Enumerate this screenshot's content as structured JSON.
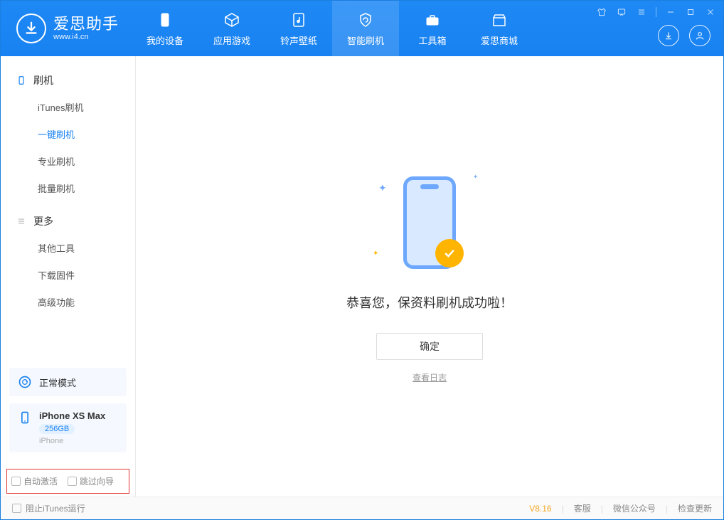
{
  "app": {
    "title": "爱思助手",
    "subtitle": "www.i4.cn"
  },
  "nav": {
    "items": [
      {
        "label": "我的设备"
      },
      {
        "label": "应用游戏"
      },
      {
        "label": "铃声壁纸"
      },
      {
        "label": "智能刷机"
      },
      {
        "label": "工具箱"
      },
      {
        "label": "爱思商城"
      }
    ]
  },
  "sidebar": {
    "group1_title": "刷机",
    "group1_items": [
      {
        "label": "iTunes刷机"
      },
      {
        "label": "一键刷机"
      },
      {
        "label": "专业刷机"
      },
      {
        "label": "批量刷机"
      }
    ],
    "group2_title": "更多",
    "group2_items": [
      {
        "label": "其他工具"
      },
      {
        "label": "下载固件"
      },
      {
        "label": "高级功能"
      }
    ],
    "mode_label": "正常模式",
    "device_name": "iPhone XS Max",
    "device_capacity": "256GB",
    "device_type": "iPhone",
    "auto_activate": "自动激活",
    "skip_guide": "跳过向导"
  },
  "main": {
    "success_text": "恭喜您，保资料刷机成功啦！",
    "ok_button": "确定",
    "view_log": "查看日志"
  },
  "footer": {
    "block_itunes": "阻止iTunes运行",
    "version": "V8.16",
    "customer_service": "客服",
    "wechat": "微信公众号",
    "check_update": "检查更新"
  }
}
